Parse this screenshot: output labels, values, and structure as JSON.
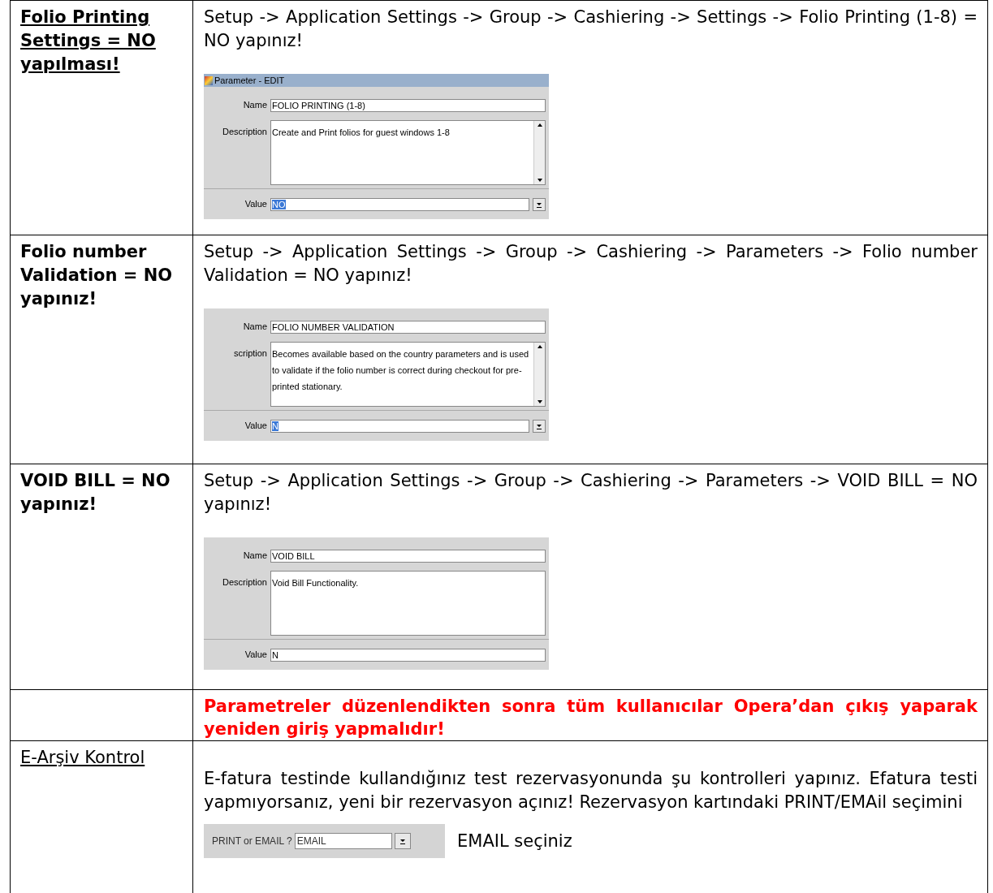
{
  "rows": [
    {
      "kind": "param",
      "title": "Folio Printing Settings = NO yapılması!",
      "bold": true,
      "underlined": true,
      "text": "Setup -> Application Settings -> Group -> Cashiering -> Settings -> Folio Printing (1-8) = NO yapınız!",
      "dialog": {
        "title": "Parameter - EDIT",
        "name_label": "Name",
        "name": "FOLIO PRINTING (1-8)",
        "description_label": "Description",
        "description": "Create and Print folios for guest windows 1-8",
        "value_label": "Value",
        "value": "NO",
        "value_selected": true,
        "scrollbar": true,
        "dropdown": true
      }
    },
    {
      "kind": "param",
      "title": "Folio number Validation = NO yapınız!",
      "bold": true,
      "underlined": false,
      "text": "Setup -> Application Settings -> Group -> Cashiering -> Parameters -> Folio number Validation = NO yapınız!",
      "dialog": {
        "name_label": "Name",
        "name": "FOLIO NUMBER VALIDATION",
        "description_label": "scription",
        "description": "Becomes available based on the country parameters and is used to validate if the folio number is correct during checkout for pre-printed stationary.",
        "value_label": "Value",
        "value": "N",
        "value_selected": true,
        "scrollbar": true,
        "dropdown": true
      }
    },
    {
      "kind": "param",
      "title": "VOID BILL = NO yapınız!",
      "bold": true,
      "underlined": false,
      "text": "Setup -> Application Settings -> Group -> Cashiering -> Parameters -> VOID BILL = NO yapınız!",
      "dialog": {
        "name_label": "Name",
        "name": "VOID BILL",
        "description_label": "Description",
        "description": "Void Bill Functionality.",
        "value_label": "Value",
        "value": "N",
        "value_selected": false,
        "scrollbar": false,
        "dropdown": false
      }
    },
    {
      "kind": "notice",
      "text": "Parametreler düzenlendikten sonra tüm kullanıcılar Opera’dan çıkış yaparak yeniden giriş yapmalıdır!"
    },
    {
      "kind": "check",
      "title": "E-Arşiv Kontrol",
      "bold": false,
      "underlined": true,
      "text": "E-fatura testinde kullandığınız test rezervasyonunda şu kontrolleri yapınız. Efatura testi yapmıyorsanız, yeni bir rezervasyon açınız! Rezervasyon kartındaki  PRINT/EMAil seçimini",
      "field": {
        "label": "PRINT or EMAIL ?",
        "value": "EMAIL"
      },
      "note": "EMAIL seçiniz"
    }
  ]
}
